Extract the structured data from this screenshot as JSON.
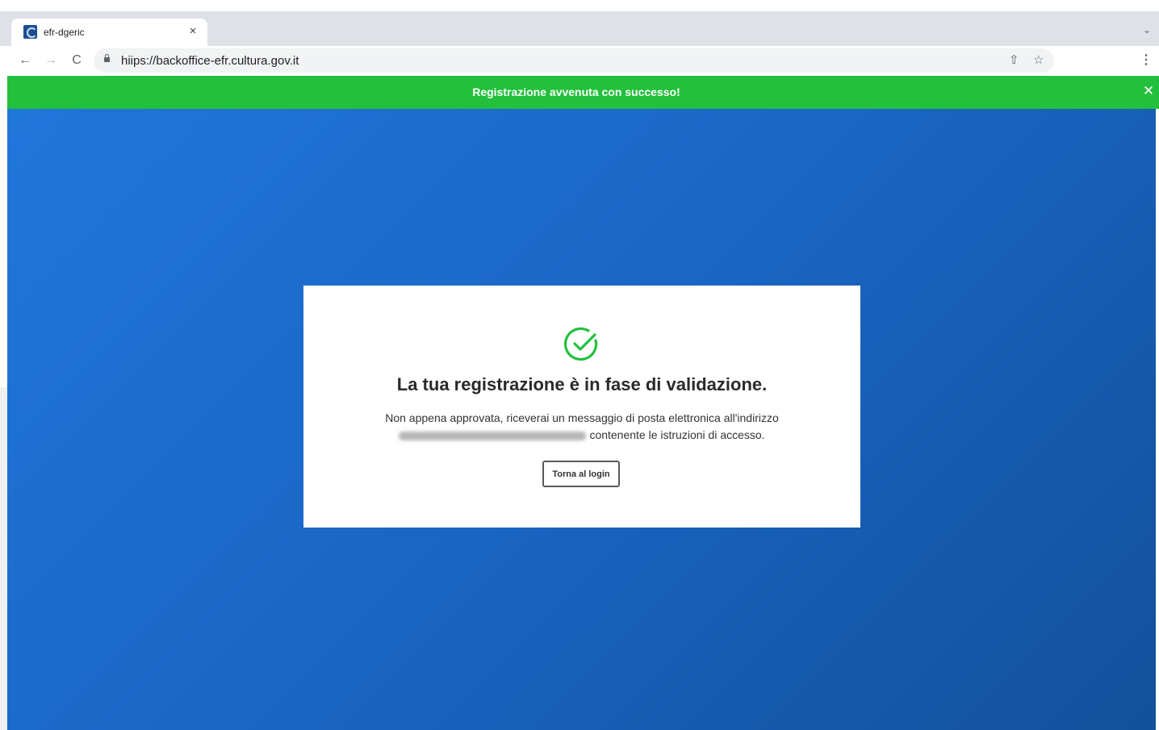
{
  "browser": {
    "tab_title": "efr-dgeric",
    "tab_close": "×",
    "tab_menu": "⌄",
    "url": "hiips://backoffice-efr.cultura.gov.it",
    "back": "←",
    "forward": "→",
    "reload": "C",
    "share": "⇧",
    "bookmark": "☆",
    "menu": "⋮"
  },
  "banner": {
    "message": "Registrazione avvenuta con successo!",
    "close": "✕",
    "color": "#22c03c"
  },
  "card": {
    "title": "La tua registrazione è in fase di validazione.",
    "text_line1": "Non appena approvata, riceverai un messaggio di posta elettronica all'indirizzo",
    "text_line2": "contenente le istruzioni di accesso.",
    "button_label": "Torna al login",
    "icon": "check-circle-icon",
    "icon_color": "#22c03c"
  },
  "colors": {
    "background_start": "#2176db",
    "background_end": "#12509a"
  }
}
